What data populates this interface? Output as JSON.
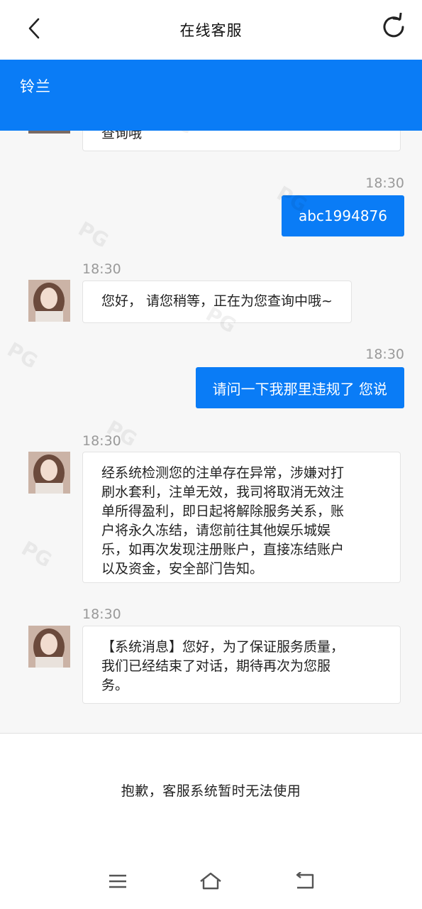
{
  "header": {
    "title": "在线客服",
    "back_icon": "chevron-left-icon",
    "refresh_icon": "refresh-icon"
  },
  "agent": {
    "name": "铃兰"
  },
  "messages": [
    {
      "side": "left",
      "text": "查询哦"
    },
    {
      "side": "right",
      "time": "18:30",
      "text": "abc1994876"
    },
    {
      "side": "left",
      "time": "18:30",
      "text": "您好， 请您稍等，正在为您查询中哦~"
    },
    {
      "side": "right",
      "time": "18:30",
      "text": "请问一下我那里违规了 您说"
    },
    {
      "side": "left",
      "time": "18:30",
      "lines": [
        "经系统检测您的注单存在异常，涉嫌对打",
        "刷水套利，注单无效，我司将取消无效注",
        "单所得盈利，即日起将解除服务关系，账",
        "户将永久冻结，请您前往其他娱乐城娱",
        "乐，如再次发现注册账户，直接冻结账户",
        "以及资金，安全部门告知。"
      ]
    },
    {
      "side": "left",
      "time": "18:30",
      "lines": [
        "【系统消息】您好，为了保证服务质量，",
        "我们已经结束了对话，期待再次为您服",
        "务。"
      ]
    }
  ],
  "bottom": {
    "notice": "抱歉，客服系统暂时无法使用"
  },
  "system_nav": {
    "menu_icon": "menu-icon",
    "home_icon": "home-icon",
    "back_icon": "back-icon"
  },
  "colors": {
    "accent": "#0a7cf6",
    "background": "#f7f7f7"
  },
  "watermark": "PG"
}
